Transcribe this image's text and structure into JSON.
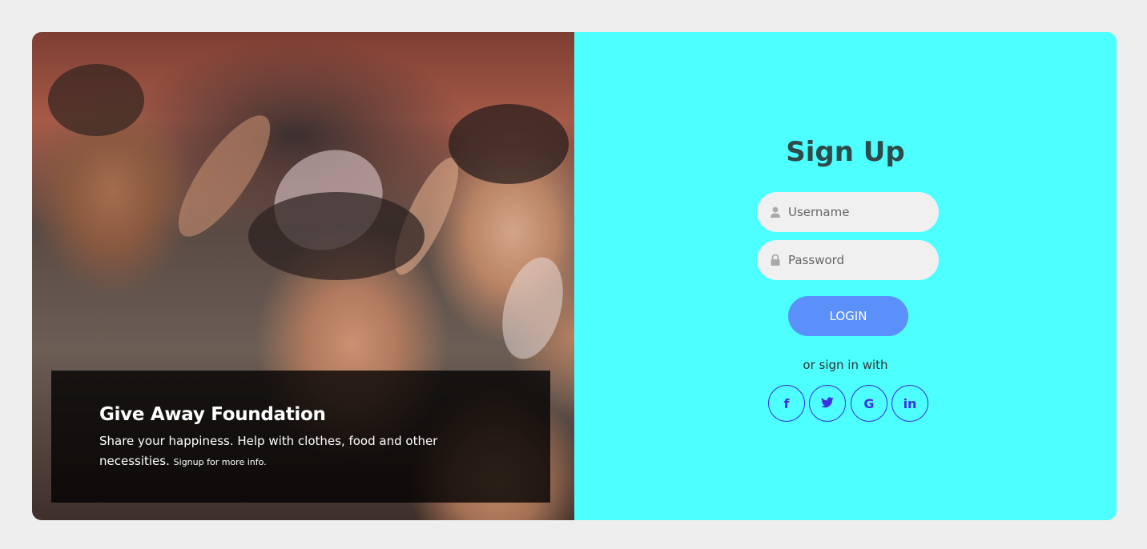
{
  "hero": {
    "image_alt": "group of smiling children making peace signs",
    "title": "Give Away Foundation",
    "text": "Share your happiness. Help with clothes, food and other necessities.",
    "small_text": "Signup for more info."
  },
  "form": {
    "title": "Sign Up",
    "username_placeholder": "Username",
    "password_placeholder": "Password",
    "login_label": "LOGIN",
    "alt_signin_text": "or sign in with"
  },
  "social": [
    {
      "name": "facebook",
      "glyph": "f",
      "icon": "facebook-icon"
    },
    {
      "name": "twitter",
      "glyph": "",
      "icon": "twitter-icon"
    },
    {
      "name": "google",
      "glyph": "G",
      "icon": "google-icon"
    },
    {
      "name": "linkedin",
      "glyph": "in",
      "icon": "linkedin-icon"
    }
  ],
  "colors": {
    "page_background": "#eeeeee",
    "form_panel": "#4dffff",
    "title_text": "#2f4a4a",
    "field_background": "#f0f0f0",
    "login_button": "#5b8ff9",
    "social_accent": "#3d32e0",
    "caption_overlay": "rgba(0,0,0,0.78)"
  }
}
